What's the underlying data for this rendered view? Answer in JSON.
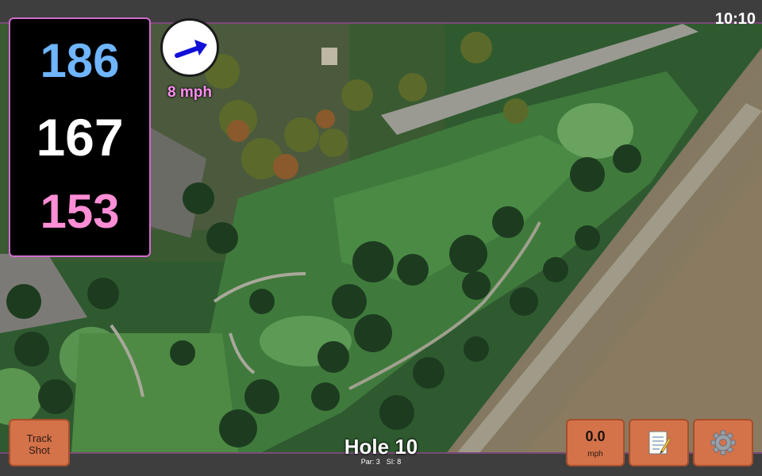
{
  "status_bar": {
    "time": "10:10"
  },
  "yardage": {
    "back": "186",
    "middle": "167",
    "front": "153"
  },
  "wind": {
    "speed_label": "8 mph",
    "direction_icon": "wind-arrow-icon"
  },
  "buttons": {
    "track_shot_line1": "Track",
    "track_shot_line2": "Shot",
    "speed_value": "0.0",
    "speed_unit": "mph",
    "notes_icon": "notepad-icon",
    "settings_icon": "gear-icon"
  },
  "hole": {
    "title": "Hole 10",
    "par": "Par: 3",
    "si": "SI: 8"
  },
  "colors": {
    "accent_border": "#d36ad1",
    "button": "#d4724a",
    "back_yardage": "#6fb5ff",
    "front_yardage": "#ff8ed6",
    "wind_label": "#ff8ef0"
  }
}
